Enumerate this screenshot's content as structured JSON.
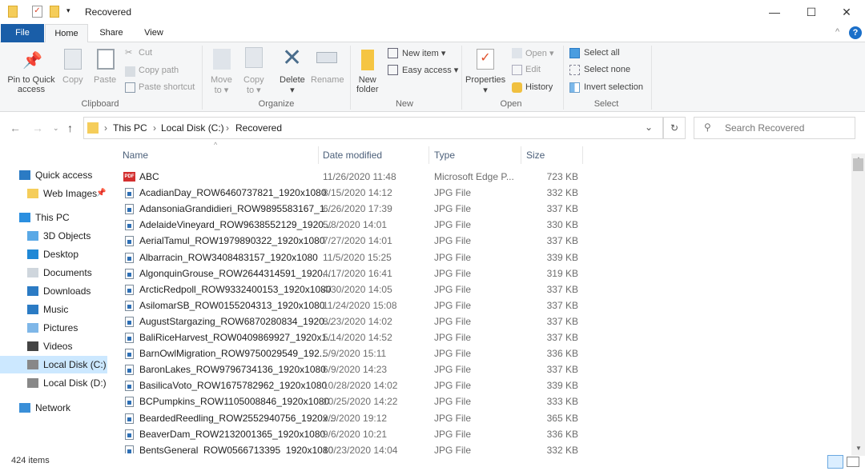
{
  "window": {
    "title": "Recovered",
    "minimize": "—",
    "maximize": "☐",
    "close": "✕"
  },
  "tabs": [
    "File",
    "Home",
    "Share",
    "View"
  ],
  "ribbon": {
    "clipboard": {
      "label": "Clipboard",
      "pin": [
        "Pin to Quick",
        "access"
      ],
      "copy": "Copy",
      "paste": "Paste",
      "cut": "Cut",
      "copy_path": "Copy path",
      "paste_shortcut": "Paste shortcut"
    },
    "organize": {
      "label": "Organize",
      "move_to": [
        "Move",
        "to ▾"
      ],
      "copy_to": [
        "Copy",
        "to ▾"
      ],
      "delete": "Delete",
      "rename": "Rename"
    },
    "new": {
      "label": "New",
      "new_folder": [
        "New",
        "folder"
      ],
      "new_item": "New item ▾",
      "easy_access": "Easy access ▾"
    },
    "open": {
      "label": "Open",
      "properties": "Properties",
      "open": "Open ▾",
      "edit": "Edit",
      "history": "History"
    },
    "select": {
      "label": "Select",
      "select_all": "Select all",
      "select_none": "Select none",
      "invert": "Invert selection"
    }
  },
  "address": {
    "crumbs": [
      "This PC",
      "Local Disk (C:)",
      "Recovered"
    ],
    "search_placeholder": "Search Recovered"
  },
  "sidebar": [
    {
      "label": "Quick access",
      "icon": "star-icon"
    },
    {
      "label": "Web Images",
      "icon": "folder-icon",
      "pinned": true
    },
    {
      "label": "This PC",
      "icon": "computer-icon"
    },
    {
      "label": "3D Objects",
      "icon": "cube-icon"
    },
    {
      "label": "Desktop",
      "icon": "desktop-icon"
    },
    {
      "label": "Documents",
      "icon": "documents-icon"
    },
    {
      "label": "Downloads",
      "icon": "download-icon"
    },
    {
      "label": "Music",
      "icon": "music-icon"
    },
    {
      "label": "Pictures",
      "icon": "pictures-icon"
    },
    {
      "label": "Videos",
      "icon": "videos-icon"
    },
    {
      "label": "Local Disk (C:)",
      "icon": "drive-icon",
      "selected": true
    },
    {
      "label": "Local Disk (D:)",
      "icon": "drive-icon"
    },
    {
      "label": "Network",
      "icon": "network-icon"
    }
  ],
  "columns": [
    "Name",
    "Date modified",
    "Type",
    "Size"
  ],
  "files": [
    {
      "name": "ABC",
      "date": "11/26/2020 11:48",
      "type": "Microsoft Edge P...",
      "size": "723 KB",
      "icon": "pdf"
    },
    {
      "name": "AcadianDay_ROW6460737821_1920x1080",
      "date": "8/15/2020 14:12",
      "type": "JPG File",
      "size": "332 KB"
    },
    {
      "name": "AdansoniaGrandidieri_ROW9895583167_1...",
      "date": "6/26/2020 17:39",
      "type": "JPG File",
      "size": "337 KB"
    },
    {
      "name": "AdelaideVineyard_ROW9638552129_1920...",
      "date": "5/8/2020 14:01",
      "type": "JPG File",
      "size": "330 KB"
    },
    {
      "name": "AerialTamul_ROW1979890322_1920x1080",
      "date": "7/27/2020 14:01",
      "type": "JPG File",
      "size": "337 KB"
    },
    {
      "name": "Albarracin_ROW3408483157_1920x1080",
      "date": "11/5/2020 15:25",
      "type": "JPG File",
      "size": "339 KB"
    },
    {
      "name": "AlgonquinGrouse_ROW2644314591_1920...",
      "date": "4/17/2020 16:41",
      "type": "JPG File",
      "size": "319 KB"
    },
    {
      "name": "ArcticRedpoll_ROW9332400153_1920x1080",
      "date": "4/30/2020 14:05",
      "type": "JPG File",
      "size": "337 KB"
    },
    {
      "name": "AsilomarSB_ROW0155204313_1920x1080",
      "date": "11/24/2020 15:08",
      "type": "JPG File",
      "size": "337 KB"
    },
    {
      "name": "AugustStargazing_ROW6870280834_1920...",
      "date": "8/23/2020 14:02",
      "type": "JPG File",
      "size": "337 KB"
    },
    {
      "name": "BaliRiceHarvest_ROW0409869927_1920x1...",
      "date": "5/14/2020 14:52",
      "type": "JPG File",
      "size": "337 KB"
    },
    {
      "name": "BarnOwlMigration_ROW9750029549_192...",
      "date": "5/9/2020 15:11",
      "type": "JPG File",
      "size": "336 KB"
    },
    {
      "name": "BaronLakes_ROW9796734136_1920x1080",
      "date": "6/9/2020 14:23",
      "type": "JPG File",
      "size": "337 KB"
    },
    {
      "name": "BasilicaVoto_ROW1675782962_1920x1080",
      "date": "10/28/2020 14:02",
      "type": "JPG File",
      "size": "339 KB"
    },
    {
      "name": "BCPumpkins_ROW1105008846_1920x1080",
      "date": "10/25/2020 14:22",
      "type": "JPG File",
      "size": "333 KB"
    },
    {
      "name": "BeardedReedling_ROW2552940756_1920x...",
      "date": "9/9/2020 19:12",
      "type": "JPG File",
      "size": "365 KB"
    },
    {
      "name": "BeaverDam_ROW2132001365_1920x1080",
      "date": "9/6/2020 10:21",
      "type": "JPG File",
      "size": "336 KB"
    },
    {
      "name": "BentsGeneral_ROW0566713395_1920x1080",
      "date": "10/23/2020 14:04",
      "type": "JPG File",
      "size": "332 KB"
    }
  ],
  "status": {
    "count": "424 items"
  },
  "colors": {
    "accent": "#1a5ea8",
    "selected": "#cce8ff"
  }
}
